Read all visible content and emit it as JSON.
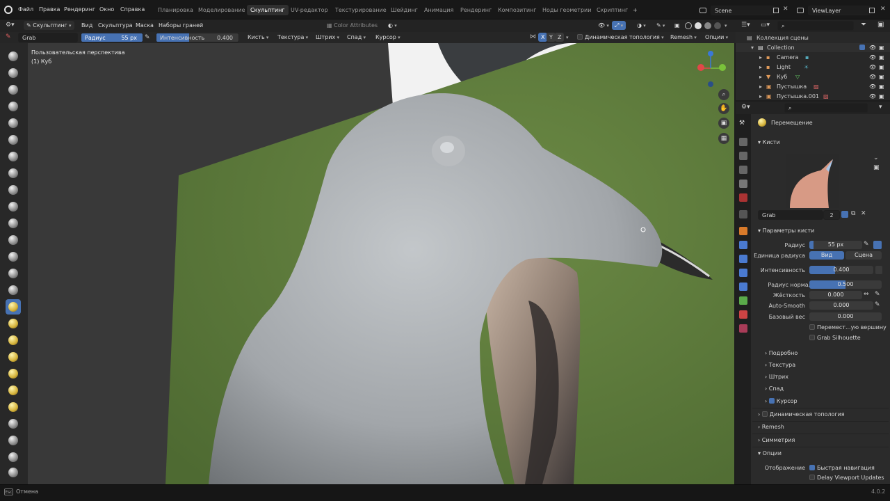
{
  "menu": [
    "Файл",
    "Правка",
    "Рендеринг",
    "Окно",
    "Справка"
  ],
  "workspaces": [
    {
      "label": "Планировка",
      "active": false
    },
    {
      "label": "Моделирование",
      "active": false
    },
    {
      "label": "Скульптинг",
      "active": true
    },
    {
      "label": "UV-редактор",
      "active": false
    },
    {
      "label": "Текстурирование",
      "active": false
    },
    {
      "label": "Шейдинг",
      "active": false
    },
    {
      "label": "Анимация",
      "active": false
    },
    {
      "label": "Рендеринг",
      "active": false
    },
    {
      "label": "Композитинг",
      "active": false
    },
    {
      "label": "Ноды геометрии",
      "active": false
    },
    {
      "label": "Скриптинг",
      "active": false
    }
  ],
  "scene": {
    "label": "Scene",
    "viewlayer": "ViewLayer"
  },
  "header2": {
    "mode": "Скульптинг",
    "items": [
      "Вид",
      "Скульптура",
      "Маска",
      "Наборы граней"
    ],
    "color_attributes": "Color Attributes"
  },
  "header3": {
    "brush_name": "Grab",
    "radius_label": "Радиус",
    "radius_value": "55 px",
    "strength_label": "Интенсивность",
    "strength_value": "0.400",
    "strength_fraction": 0.4,
    "menus": [
      "Кисть",
      "Текстура",
      "Штрих",
      "Спад",
      "Курсор"
    ],
    "axes": [
      "X",
      "Y",
      "Z"
    ],
    "dyntopo": "Динамическая топология",
    "remesh": "Remesh",
    "options": "Опции"
  },
  "viewport": {
    "perspective": "Пользовательская перспектива",
    "object": "(1) Куб"
  },
  "outliner": {
    "collection_root": "Коллекция сцены",
    "items": [
      {
        "label": "Collection",
        "indent": 1
      },
      {
        "label": "Camera",
        "indent": 2
      },
      {
        "label": "Light",
        "indent": 2
      },
      {
        "label": "Куб",
        "indent": 2
      },
      {
        "label": "Пустышка",
        "indent": 2
      },
      {
        "label": "Пустышка.001",
        "indent": 2
      }
    ]
  },
  "properties": {
    "tool_name": "Перемещение",
    "brushes_section": "Кисти",
    "brush_field": "Grab",
    "brush_users": "2",
    "brush_params_section": "Параметры кисти",
    "radius_label": "Радиус",
    "radius_value": "55 px",
    "radius_unit_label": "Единица радиуса",
    "unit_view": "Вид",
    "unit_scene": "Сцена",
    "strength_label": "Интенсивность",
    "strength_value": "0.400",
    "strength_fraction": 0.4,
    "normal_radius_label": "Радиус нормали",
    "normal_radius_value": "0.500",
    "normal_radius_fraction": 0.5,
    "hardness_label": "Жёсткость",
    "hardness_value": "0.000",
    "autosmooth_label": "Auto-Smooth",
    "autosmooth_value": "0.000",
    "plane_offset_label": "Базовый вес",
    "plane_offset_value": "0.000",
    "check_move_vertex": "Перемест...ую вершину",
    "check_grab_silhouette": "Grab Silhouette",
    "subsections": [
      "Подробно",
      "Текстура",
      "Штрих",
      "Спад"
    ],
    "cursor_section": "Курсор",
    "dyntopo_section": "Динамическая топология",
    "remesh_section": "Remesh",
    "symmetry_section": "Симметрия",
    "options_section": "Опции",
    "display_label": "Отображение",
    "fast_nav": "Быстрая навигация",
    "delay_updates": "Delay Viewport Updates"
  },
  "status": {
    "left": "Отмена",
    "version": "4.0.2"
  },
  "colors": {
    "accent": "#4772b3",
    "grass": "#5a7a3a",
    "bird_body": "#a9adb1"
  }
}
